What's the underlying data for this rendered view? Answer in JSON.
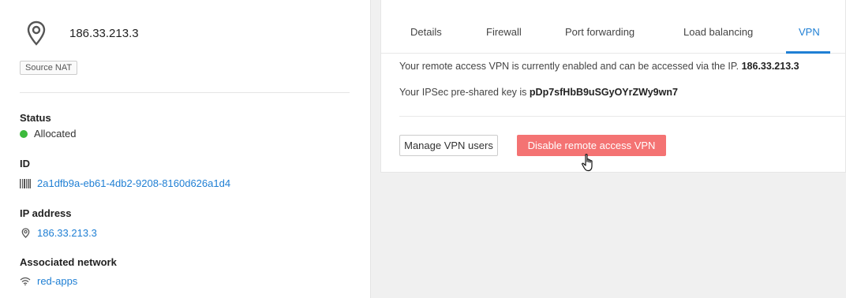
{
  "header": {
    "ip": "186.33.213.3",
    "badge": "Source NAT"
  },
  "properties": {
    "status": {
      "label": "Status",
      "value": "Allocated",
      "color": "#3cba3c"
    },
    "id": {
      "label": "ID",
      "value": "2a1dfb9a-eb61-4db2-9208-8160d626a1d4"
    },
    "ip_address": {
      "label": "IP address",
      "value": "186.33.213.3"
    },
    "network": {
      "label": "Associated network",
      "value": "red-apps"
    }
  },
  "tabs": [
    {
      "label": "Details"
    },
    {
      "label": "Firewall"
    },
    {
      "label": "Port forwarding"
    },
    {
      "label": "Load balancing"
    },
    {
      "label": "VPN"
    }
  ],
  "active_tab": "VPN",
  "vpn": {
    "line1_prefix": "Your remote access VPN is currently enabled and can be accessed via the IP.",
    "line1_ip": "186.33.213.3",
    "line2_prefix": "Your IPSec pre-shared key is",
    "psk": "pDp7sfHbB9uSGyOYrZWy9wn7",
    "manage_button": "Manage VPN users",
    "disable_button": "Disable remote access VPN"
  },
  "colors": {
    "accent": "#1f7fd4",
    "danger": "#f47373",
    "success": "#3cba3c"
  }
}
